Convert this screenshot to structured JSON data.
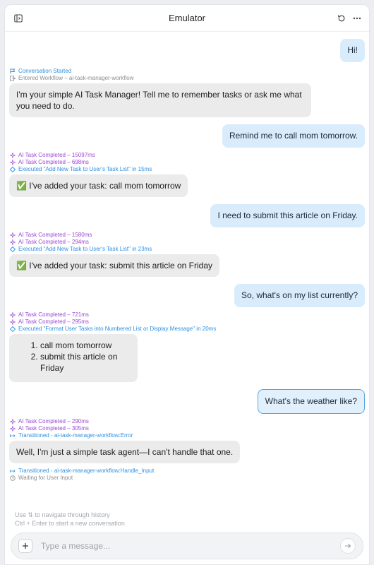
{
  "header": {
    "title": "Emulator"
  },
  "messages": {
    "user_1": "Hi!",
    "ev_started": "Conversation Started",
    "ev_workflow": "Entered Workflow – ai-task-manager-workflow",
    "bot_1": "I'm your simple AI Task Manager! Tell me to remember tasks or ask me what you need to do.",
    "user_2": "Remind me to call mom tomorrow.",
    "ev_2a": "AI Task Completed – 15097ms",
    "ev_2b": "AI Task Completed – 698ms",
    "ev_2c": "Executed \"Add New Task to User's Task List\" in 15ms",
    "bot_2": "✅ I've added your task: call mom tomorrow",
    "user_3": "I need to submit this article on Friday.",
    "ev_3a": "AI Task Completed – 1580ms",
    "ev_3b": "AI Task Completed – 294ms",
    "ev_3c": "Executed \"Add New Task to User's Task List\" in 23ms",
    "bot_3": "✅ I've added your task: submit this article on Friday",
    "user_4": "So, what's on my list currently?",
    "ev_4a": "AI Task Completed – 721ms",
    "ev_4b": "AI Task Completed – 295ms",
    "ev_4c": "Executed \"Format User Tasks into Numbered List or Display Message\" in 20ms",
    "list_items": [
      "call mom tomorrow",
      "submit this article on Friday"
    ],
    "user_5": "What's the weather like?",
    "ev_5a": "AI Task Completed – 290ms",
    "ev_5b": "AI Task Completed – 305ms",
    "ev_5c": "Transitioned - ai-task-manager-workflow:Error",
    "bot_5": "Well, I'm just a simple task agent—I can't handle that one.",
    "ev_6a": "Transitioned - ai-task-manager-workflow:Handle_Input",
    "ev_6b": "Waiting for User Input"
  },
  "hints": {
    "history": "Use ⇅ to navigate through history",
    "new_conversation": "Ctrl + Enter to start a new conversation"
  },
  "composer": {
    "placeholder": "Type a message..."
  },
  "colors": {
    "ai_event": "#9b48d4",
    "action_event": "#2d8fe0",
    "user_bubble": "#d9ecfb",
    "bot_bubble": "#ebebeb"
  },
  "icons": [
    "sidebar-toggle-icon",
    "refresh-icon",
    "more-icon",
    "flag-icon",
    "enter-workflow-icon",
    "sparkle-icon",
    "bolt-icon",
    "transition-icon",
    "wait-icon",
    "plus-icon",
    "send-arrow-icon"
  ]
}
